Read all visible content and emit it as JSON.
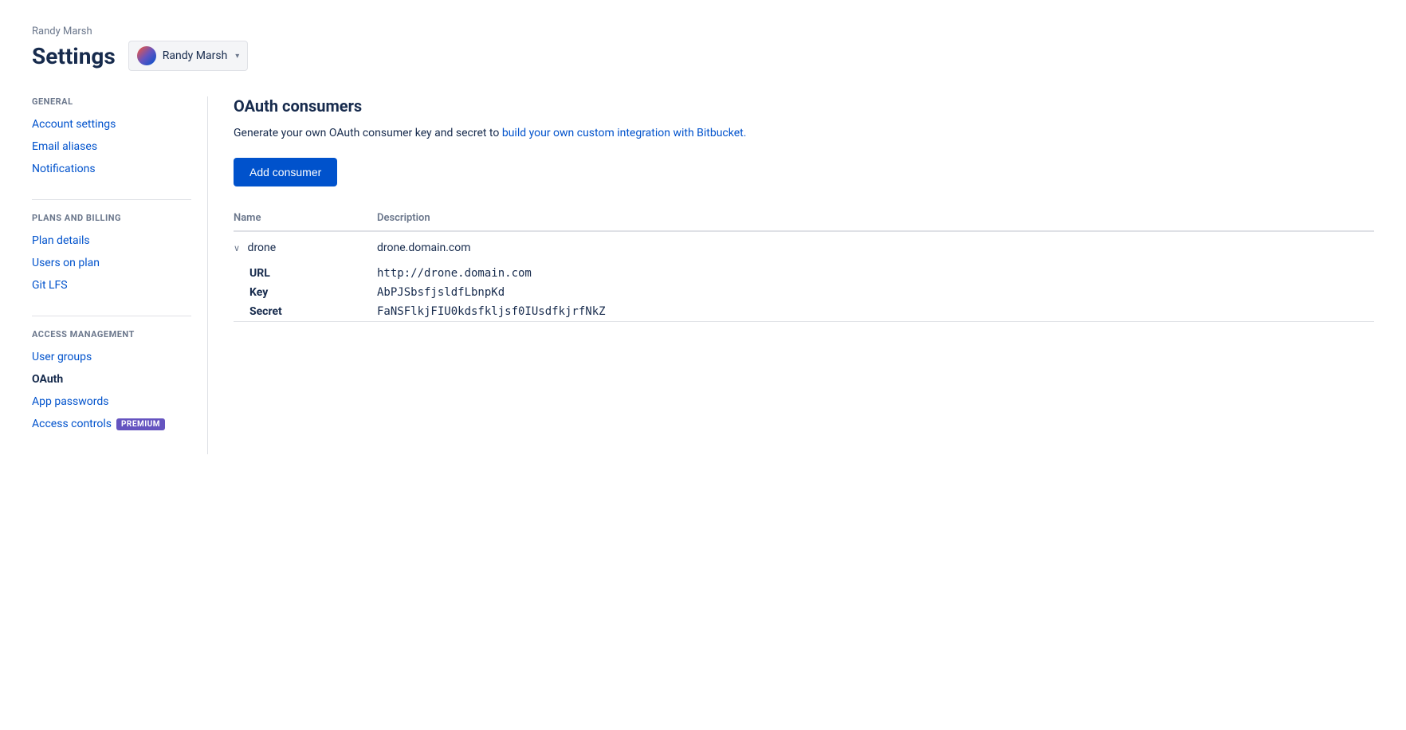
{
  "header": {
    "username": "Randy Marsh",
    "title": "Settings",
    "selector_label": "Randy Marsh",
    "chevron": "▾"
  },
  "sidebar": {
    "sections": [
      {
        "id": "general",
        "title": "GENERAL",
        "items": [
          {
            "id": "account-settings",
            "label": "Account settings",
            "active": false,
            "premium": false
          },
          {
            "id": "email-aliases",
            "label": "Email aliases",
            "active": false,
            "premium": false
          },
          {
            "id": "notifications",
            "label": "Notifications",
            "active": false,
            "premium": false
          }
        ]
      },
      {
        "id": "plans-billing",
        "title": "PLANS AND BILLING",
        "items": [
          {
            "id": "plan-details",
            "label": "Plan details",
            "active": false,
            "premium": false
          },
          {
            "id": "users-on-plan",
            "label": "Users on plan",
            "active": false,
            "premium": false
          },
          {
            "id": "git-lfs",
            "label": "Git LFS",
            "active": false,
            "premium": false
          }
        ]
      },
      {
        "id": "access-management",
        "title": "ACCESS MANAGEMENT",
        "items": [
          {
            "id": "user-groups",
            "label": "User groups",
            "active": false,
            "premium": false
          },
          {
            "id": "oauth",
            "label": "OAuth",
            "active": true,
            "premium": false
          },
          {
            "id": "app-passwords",
            "label": "App passwords",
            "active": false,
            "premium": false
          },
          {
            "id": "access-controls",
            "label": "Access controls",
            "active": false,
            "premium": true
          }
        ]
      }
    ]
  },
  "content": {
    "title": "OAuth consumers",
    "description_before": "Generate your own OAuth consumer key and secret to ",
    "description_link": "build your own custom integration with Bitbucket.",
    "description_link_href": "#",
    "add_button_label": "Add consumer",
    "table": {
      "columns": [
        {
          "id": "name",
          "label": "Name"
        },
        {
          "id": "description",
          "label": "Description"
        }
      ],
      "rows": [
        {
          "id": "drone-row",
          "name": "drone",
          "description": "drone.domain.com",
          "expanded": true,
          "chevron": "∨",
          "details": [
            {
              "label": "URL",
              "value": "http://drone.domain.com"
            },
            {
              "label": "Key",
              "value": "AbPJSbsfjsldfLbnpKd"
            },
            {
              "label": "Secret",
              "value": "FaNSFlkjFIU0kdsfkljsf0IUsdfkjrfNkZ"
            }
          ]
        }
      ]
    }
  },
  "premium_badge_label": "PREMIUM"
}
